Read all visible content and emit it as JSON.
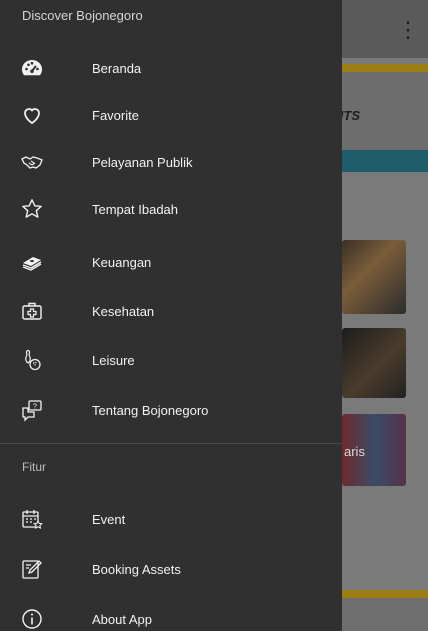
{
  "background_app": {
    "tab_text": "NTS",
    "card_text": "aris"
  },
  "drawer": {
    "header": "Discover Bojonegoro",
    "items": [
      {
        "label": "Beranda",
        "icon": "dashboard-icon"
      },
      {
        "label": "Favorite",
        "icon": "heart-icon"
      },
      {
        "label": "Pelayanan Publik",
        "icon": "handshake-icon"
      },
      {
        "label": "Tempat Ibadah",
        "icon": "star-icon"
      },
      {
        "label": "Keuangan",
        "icon": "money-stack-icon"
      },
      {
        "label": "Kesehatan",
        "icon": "medical-kit-icon"
      },
      {
        "label": "Leisure",
        "icon": "bowling-icon"
      },
      {
        "label": "Tentang Bojonegoro",
        "icon": "help-chat-icon"
      }
    ],
    "section_label": "Fitur",
    "feature_items": [
      {
        "label": "Event",
        "icon": "calendar-star-icon"
      },
      {
        "label": "Booking Assets",
        "icon": "edit-document-icon"
      },
      {
        "label": "About App",
        "icon": "info-icon"
      }
    ]
  },
  "colors": {
    "drawer_bg": "#303030",
    "accent_gold": "#9b7d14",
    "accent_teal": "#1f5d6b"
  }
}
